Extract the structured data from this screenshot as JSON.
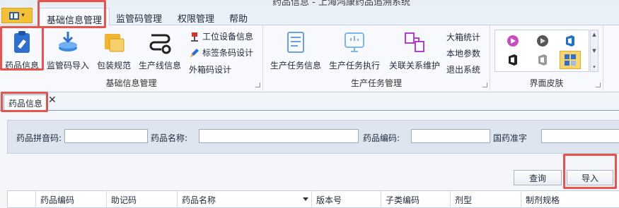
{
  "window": {
    "title": "药品信息 - 上海鸿康药品追溯系统"
  },
  "ribbon_tabs": [
    {
      "label": "基础信息管理",
      "active": true
    },
    {
      "label": "监管码管理",
      "active": false
    },
    {
      "label": "权限管理",
      "active": false
    },
    {
      "label": "帮助",
      "active": false
    }
  ],
  "groups": {
    "basic": {
      "label": "基础信息管理",
      "buttons": [
        "药品信息",
        "监管码导入",
        "包装规范",
        "生产线信息"
      ],
      "small": [
        "工位设备信息",
        "标签条码设计",
        "外箱码设计"
      ]
    },
    "task": {
      "label": "生产任务管理",
      "buttons": [
        "生产任务信息",
        "生产任务执行",
        "关联关系维护"
      ],
      "small": [
        "大箱统计",
        "本地参数",
        "退出系统"
      ]
    },
    "skin": {
      "label": "界面皮肤"
    }
  },
  "doc_tab": {
    "label": "药品信息",
    "close": "✕"
  },
  "filters": [
    {
      "label": "药品拼音码:",
      "value": ""
    },
    {
      "label": "药品名称:",
      "value": ""
    },
    {
      "label": "药品编码:",
      "value": ""
    },
    {
      "label": "国药准字",
      "value": ""
    }
  ],
  "buttons": {
    "query": "查询",
    "import": "导入"
  },
  "columns": [
    "药品编码",
    "助记码",
    "药品名称",
    "版本号",
    "子类编码",
    "剂型",
    "制剂规格"
  ],
  "colors": {
    "accent": "#e8534e",
    "ribbon_blue": "#2f6fcf",
    "skin_selected": "#f9d36b"
  }
}
